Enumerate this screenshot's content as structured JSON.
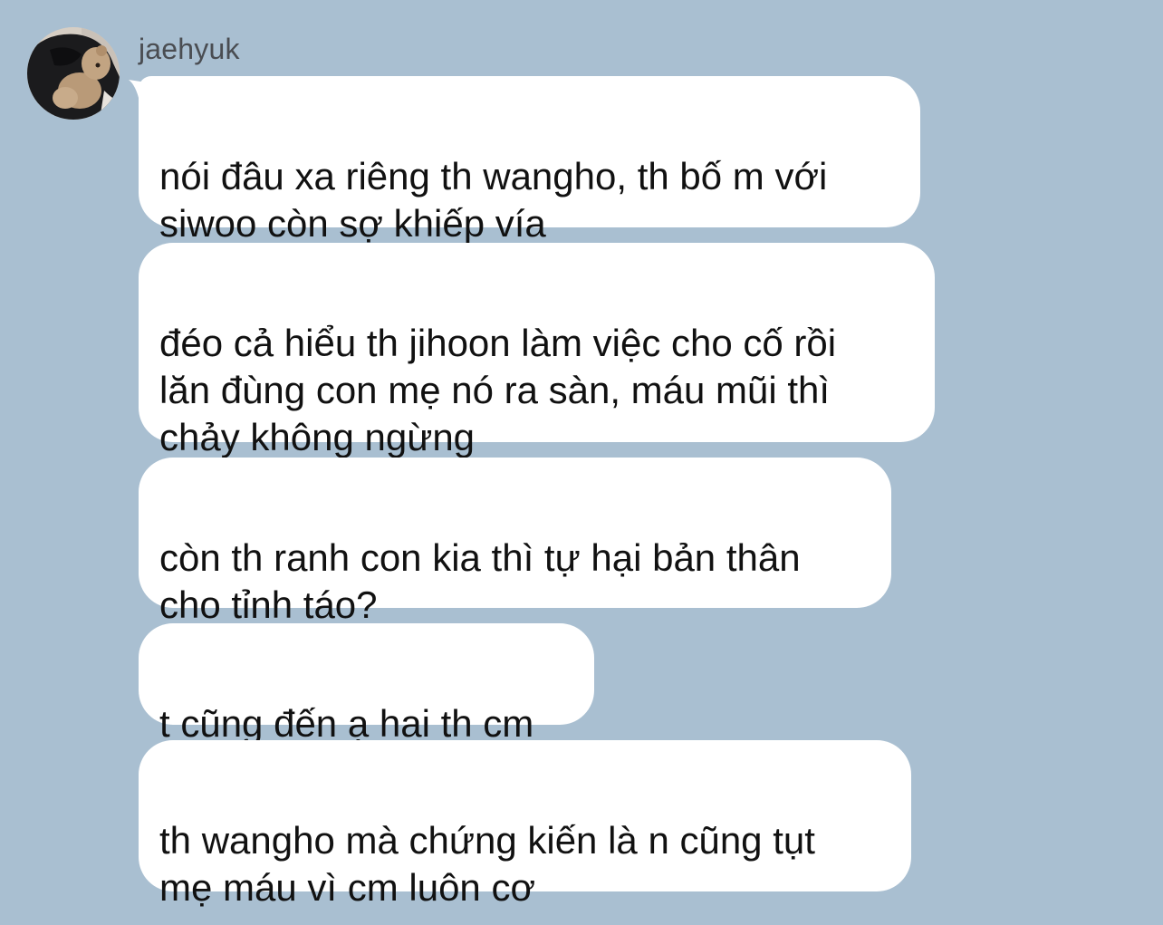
{
  "conversation": {
    "sender": {
      "name": "jaehyuk",
      "avatar_icon": "avatar-dark-hoodie-teddy-bear-icon"
    },
    "messages": [
      {
        "text": "nói đâu xa riêng th wangho, th bố m với\nsiwoo còn sợ khiếp vía"
      },
      {
        "text": "đéo cả hiểu th jihoon làm việc cho cố rồi\nlăn đùng con mẹ nó ra sàn, máu mũi thì\nchảy không ngừng"
      },
      {
        "text": "còn th ranh con kia thì tự hại bản thân\ncho tỉnh táo?"
      },
      {
        "text": "t cũng đến ạ hai th cm"
      },
      {
        "text": "th wangho mà chứng kiến là n cũng tụt\nmẹ máu vì cm luôn cơ"
      }
    ]
  },
  "colors": {
    "background": "#a9bfd1",
    "bubble": "#ffffff",
    "text": "#111111",
    "name": "#4a4d52"
  }
}
